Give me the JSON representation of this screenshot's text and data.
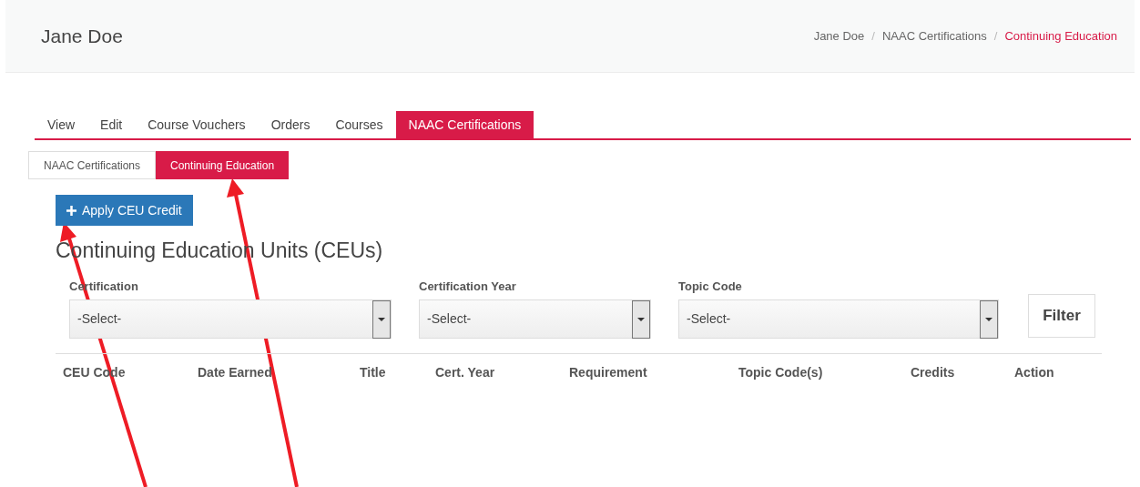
{
  "header": {
    "title": "Jane Doe",
    "breadcrumb": [
      {
        "label": "Jane Doe",
        "selected": false
      },
      {
        "label": "NAAC Certifications",
        "selected": false
      },
      {
        "label": "Continuing Education",
        "selected": true
      }
    ],
    "separator": "/"
  },
  "tabs": [
    {
      "label": "View",
      "selected": false
    },
    {
      "label": "Edit",
      "selected": false
    },
    {
      "label": "Course Vouchers",
      "selected": false
    },
    {
      "label": "Orders",
      "selected": false
    },
    {
      "label": "Courses",
      "selected": false
    },
    {
      "label": "NAAC Certifications",
      "selected": true
    }
  ],
  "subtabs": [
    {
      "label": "NAAC Certifications",
      "selected": false
    },
    {
      "label": "Continuing Education",
      "selected": true
    }
  ],
  "apply_button": {
    "label": "Apply CEU Credit"
  },
  "heading": "Continuing Education Units (CEUs)",
  "filters": [
    {
      "label": "Certification",
      "value": "-Select-"
    },
    {
      "label": "Certification Year",
      "value": "-Select-"
    },
    {
      "label": "Topic Code",
      "value": "-Select-"
    }
  ],
  "filter_button": "Filter",
  "table": {
    "columns": [
      "CEU Code",
      "Date Earned",
      "Title",
      "Cert. Year",
      "Requirement",
      "Topic Code(s)",
      "Credits",
      "Action"
    ]
  }
}
